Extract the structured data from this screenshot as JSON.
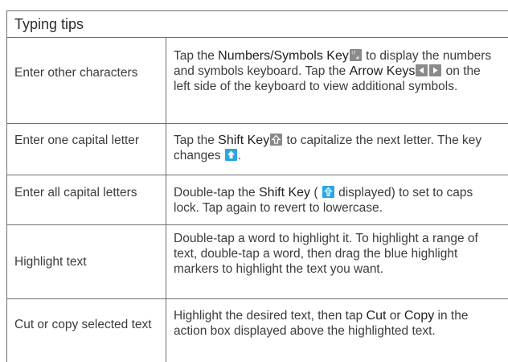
{
  "table": {
    "title": "Typing tips",
    "rows": [
      {
        "action": "Enter other characters",
        "desc": {
          "t1": "Tap the ",
          "k1": "Numbers/Symbols Key",
          "t2": " to display the numbers and symbols keyboard. Tap the ",
          "k2": "Arrow Keys",
          "t3": " on the left side of the keyboard to view additional symbols."
        }
      },
      {
        "action": "Enter one capital letter",
        "desc": {
          "t1": "Tap the ",
          "k1": "Shift Key",
          "t2": " to capitalize the next letter. The key changes ",
          "t3": "."
        }
      },
      {
        "action": "Enter all capital letters",
        "desc": {
          "t1": "Double-tap the ",
          "k1": "Shift Key",
          "t2": " ( ",
          "t3": " displayed) to set to caps lock. Tap again to revert to lowercase."
        }
      },
      {
        "action": "Highlight text",
        "desc": {
          "t1": "Double-tap a word to highlight it. To highlight a range of text, double-tap a word, then drag the blue highlight markers to highlight the text you want."
        }
      },
      {
        "action": "Cut or copy selected text",
        "desc": {
          "t1": "Highlight the desired text, then tap ",
          "k1": "Cut",
          "t2": " or ",
          "k2": "Copy",
          "t3": " in the action box displayed above the highlighted text."
        }
      }
    ]
  },
  "icons": {
    "numbers_symbols_key": "numbers-symbols-key-icon",
    "arrow_keys": "arrow-keys-icon",
    "shift_key": "shift-key-icon",
    "shift_key_active": "shift-key-active-icon",
    "shift_key_caps_lock": "shift-key-caps-lock-icon"
  },
  "colors": {
    "border": "#6e6e6e",
    "text": "#3c3c3c",
    "key_gray": "#8a8a8a",
    "key_blue": "#2aa6e0",
    "key_light_blue": "#7fd0f5"
  }
}
